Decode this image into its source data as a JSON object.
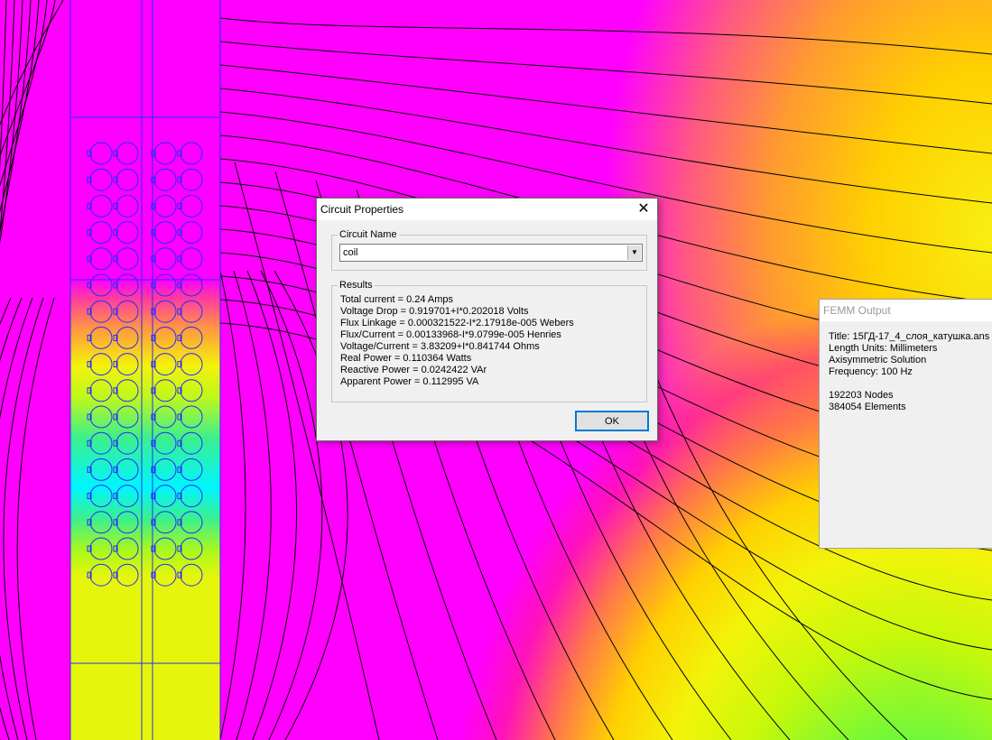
{
  "dialog": {
    "title": "Circuit Properties",
    "close_glyph": "✕",
    "circuit_group_label": "Circuit Name",
    "circuit_selected": "coil",
    "dropdown_glyph": "▼",
    "results_group_label": "Results",
    "results": [
      "Total current = 0.24 Amps",
      "Voltage Drop = 0.919701+I*0.202018 Volts",
      "Flux Linkage = 0.000321522-I*2.17918e-005 Webers",
      "Flux/Current = 0.00133968-I*9.0799e-005 Henries",
      "Voltage/Current = 3.83209+I*0.841744 Ohms",
      "Real Power = 0.110364 Watts",
      "Reactive Power = 0.0242422 VAr",
      "Apparent Power = 0.112995 VA"
    ],
    "ok_label": "OK"
  },
  "femm_output": {
    "title": "FEMM Output",
    "lines": [
      "Title: 15ГД-17_4_слоя_катушка.ans",
      "Length Units: Millimeters",
      "Axisymmetric Solution",
      "Frequency: 100 Hz"
    ],
    "stats": [
      "192203 Nodes",
      "384054 Elements"
    ]
  },
  "colors": {
    "low_field": "#ff00ff",
    "mid_field": "#ffd000",
    "high_field": "#22f46a",
    "peak_field": "#00f5ff",
    "geometry_lines": "#0000ff",
    "flux_lines": "#000000"
  }
}
